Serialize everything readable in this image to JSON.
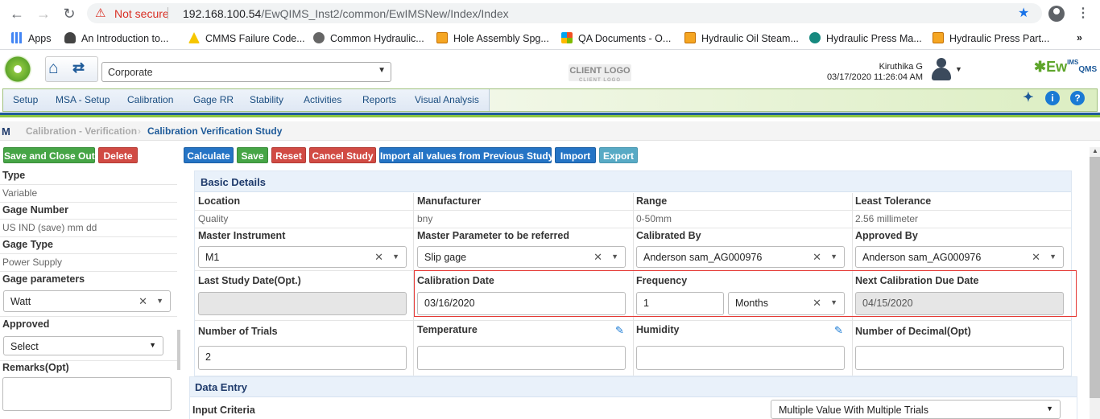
{
  "browser": {
    "security_label": "Not secure",
    "url_host": "192.168.100.54",
    "url_path": "/EwQIMS_Inst2/common/EwIMSNew/Index/Index",
    "bookmarks": [
      {
        "label": "Apps",
        "icon": "apps-grid-icon"
      },
      {
        "label": "An Introduction to...",
        "icon": "car-icon"
      },
      {
        "label": "CMMS Failure Code...",
        "icon": "warning-triangle-icon"
      },
      {
        "label": "Common Hydraulic...",
        "icon": "globe-icon"
      },
      {
        "label": "Hole Assembly Spg...",
        "icon": "doc-icon"
      },
      {
        "label": "QA Documents - O...",
        "icon": "windows-icon"
      },
      {
        "label": "Hydraulic Oil Steam...",
        "icon": "doc-icon"
      },
      {
        "label": "Hydraulic Press Ma...",
        "icon": "m-logo-icon"
      },
      {
        "label": "Hydraulic Press Part...",
        "icon": "doc-icon"
      }
    ]
  },
  "header": {
    "company": "Corporate",
    "client_logo": "CLIENT LOGO",
    "client_logo_sub": "CLIENT LOGO",
    "user_name": "Kiruthika G",
    "datetime": "03/17/2020 11:26:04 AM",
    "brand": "Ew",
    "brand_sub": "IMS",
    "brand_tail": "QMS"
  },
  "menu": [
    "Setup",
    "MSA - Setup",
    "Calibration",
    "Gage RR",
    "Stability",
    "Activities",
    "Reports",
    "Visual Analysis"
  ],
  "breadcrumb": {
    "root_icon": "M",
    "parent": "Calibration - Verification",
    "current": "Calibration Verification Study"
  },
  "left_panel": {
    "buttons": {
      "save_close": "Save and Close Out",
      "delete": "Delete"
    },
    "type_label": "Type",
    "type_value": "Variable",
    "gage_number_label": "Gage Number",
    "gage_number_value": "US IND (save) mm dd",
    "gage_type_label": "Gage Type",
    "gage_type_value": "Power Supply",
    "gage_params_label": "Gage parameters",
    "gage_params_value": "Watt",
    "approved_label": "Approved",
    "approved_value": "Select",
    "remarks_label": "Remarks(Opt)"
  },
  "toolbar": {
    "calculate": "Calculate",
    "save": "Save",
    "reset": "Reset",
    "cancel": "Cancel Study",
    "import_prev": "Import all values from Previous Study",
    "import": "Import",
    "export": "Export"
  },
  "basic": {
    "title": "Basic Details",
    "location_label": "Location",
    "location_value": "Quality",
    "manufacturer_label": "Manufacturer",
    "manufacturer_value": "bny",
    "range_label": "Range",
    "range_value": "0-50mm",
    "tolerance_label": "Least Tolerance",
    "tolerance_value": "2.56 millimeter",
    "master_instrument_label": "Master Instrument",
    "master_instrument_value": "M1",
    "master_param_label": "Master Parameter to be referred",
    "master_param_value": "Slip gage",
    "calibrated_by_label": "Calibrated By",
    "calibrated_by_value": "Anderson sam_AG000976",
    "approved_by_label": "Approved By",
    "approved_by_value": "Anderson sam_AG000976",
    "last_study_label": "Last Study Date(Opt.)",
    "last_study_value": "",
    "cal_date_label": "Calibration Date",
    "cal_date_value": "03/16/2020",
    "frequency_label": "Frequency",
    "frequency_value": "1",
    "frequency_unit": "Months",
    "next_due_label": "Next Calibration Due Date",
    "next_due_value": "04/15/2020",
    "trials_label": "Number of Trials",
    "trials_value": "2",
    "temperature_label": "Temperature",
    "temperature_value": "",
    "humidity_label": "Humidity",
    "humidity_value": "",
    "decimal_label": "Number of Decimal(Opt)",
    "decimal_value": ""
  },
  "data_entry": {
    "title": "Data Entry",
    "input_criteria_label": "Input Criteria",
    "input_criteria_value": "Multiple Value With Multiple Trials"
  }
}
